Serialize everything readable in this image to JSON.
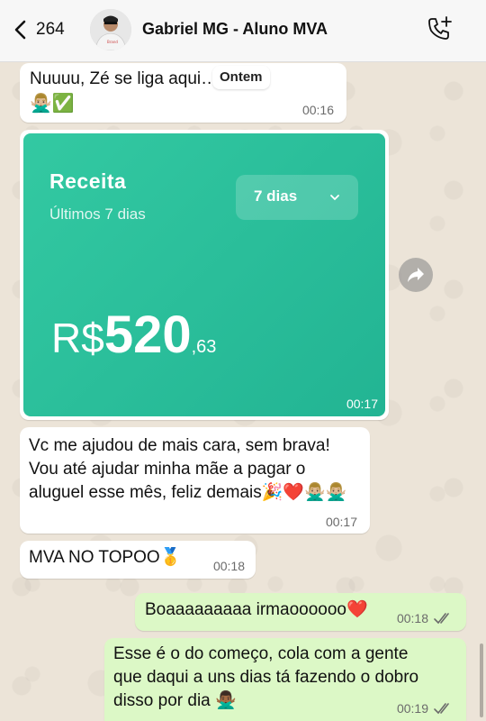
{
  "header": {
    "back_count": "264",
    "contact_name": "Gabriel MG - Aluno MVA"
  },
  "date_separator": "Ontem",
  "messages": [
    {
      "text": "Nuuuu, Zé se liga aqui…  7 dias",
      "emoji": "🙅🏼‍♂️✅",
      "time": "00:16"
    },
    {
      "card": {
        "title": "Receita",
        "subtitle": "Últimos 7 dias",
        "period": "7 dias",
        "currency": "R$",
        "amount": "520",
        "cents": ",63"
      },
      "time": "00:17"
    },
    {
      "text": "Vc me ajudou de mais cara, sem brava! Vou até ajudar minha mãe a pagar o aluguel esse mês, feliz demais🎉❤️🙅🏼‍♂️🙅🏼‍♂️",
      "time": "00:17"
    },
    {
      "text": "MVA NO TOPOO🥇",
      "time": "00:18"
    },
    {
      "text": "Boaaaaaaaaa irmaoooooo❤️",
      "time": "00:18"
    },
    {
      "text": "Esse é o do começo, cola com a gente que daqui a uns dias tá fazendo o dobro disso por dia 🙅🏾‍♂️",
      "time": "00:19"
    }
  ],
  "colors": {
    "incoming_bubble": "#ffffff",
    "outgoing_bubble": "#dcf8c6",
    "card_green": "#2bbf9a",
    "read_ticks": "#6b6b6b"
  },
  "icons": [
    "back-chevron-icon",
    "call-add-icon",
    "forward-icon",
    "double-check-icon",
    "chevron-down-icon"
  ]
}
